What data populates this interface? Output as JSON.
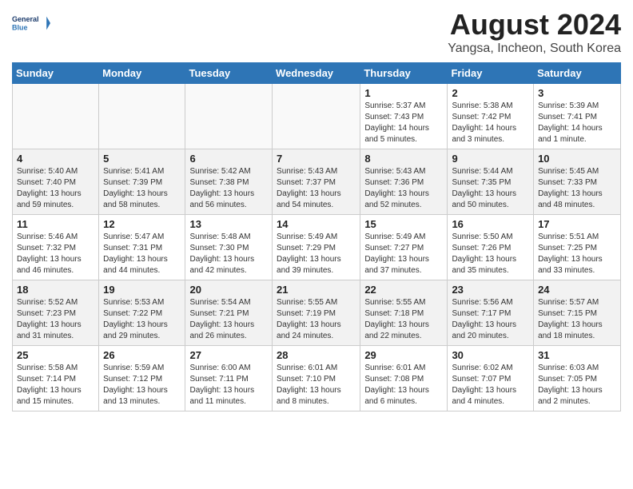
{
  "header": {
    "logo_line1": "General",
    "logo_line2": "Blue",
    "month_year": "August 2024",
    "location": "Yangsa, Incheon, South Korea"
  },
  "days_of_week": [
    "Sunday",
    "Monday",
    "Tuesday",
    "Wednesday",
    "Thursday",
    "Friday",
    "Saturday"
  ],
  "weeks": [
    [
      {
        "day": "",
        "info": ""
      },
      {
        "day": "",
        "info": ""
      },
      {
        "day": "",
        "info": ""
      },
      {
        "day": "",
        "info": ""
      },
      {
        "day": "1",
        "info": "Sunrise: 5:37 AM\nSunset: 7:43 PM\nDaylight: 14 hours\nand 5 minutes."
      },
      {
        "day": "2",
        "info": "Sunrise: 5:38 AM\nSunset: 7:42 PM\nDaylight: 14 hours\nand 3 minutes."
      },
      {
        "day": "3",
        "info": "Sunrise: 5:39 AM\nSunset: 7:41 PM\nDaylight: 14 hours\nand 1 minute."
      }
    ],
    [
      {
        "day": "4",
        "info": "Sunrise: 5:40 AM\nSunset: 7:40 PM\nDaylight: 13 hours\nand 59 minutes."
      },
      {
        "day": "5",
        "info": "Sunrise: 5:41 AM\nSunset: 7:39 PM\nDaylight: 13 hours\nand 58 minutes."
      },
      {
        "day": "6",
        "info": "Sunrise: 5:42 AM\nSunset: 7:38 PM\nDaylight: 13 hours\nand 56 minutes."
      },
      {
        "day": "7",
        "info": "Sunrise: 5:43 AM\nSunset: 7:37 PM\nDaylight: 13 hours\nand 54 minutes."
      },
      {
        "day": "8",
        "info": "Sunrise: 5:43 AM\nSunset: 7:36 PM\nDaylight: 13 hours\nand 52 minutes."
      },
      {
        "day": "9",
        "info": "Sunrise: 5:44 AM\nSunset: 7:35 PM\nDaylight: 13 hours\nand 50 minutes."
      },
      {
        "day": "10",
        "info": "Sunrise: 5:45 AM\nSunset: 7:33 PM\nDaylight: 13 hours\nand 48 minutes."
      }
    ],
    [
      {
        "day": "11",
        "info": "Sunrise: 5:46 AM\nSunset: 7:32 PM\nDaylight: 13 hours\nand 46 minutes."
      },
      {
        "day": "12",
        "info": "Sunrise: 5:47 AM\nSunset: 7:31 PM\nDaylight: 13 hours\nand 44 minutes."
      },
      {
        "day": "13",
        "info": "Sunrise: 5:48 AM\nSunset: 7:30 PM\nDaylight: 13 hours\nand 42 minutes."
      },
      {
        "day": "14",
        "info": "Sunrise: 5:49 AM\nSunset: 7:29 PM\nDaylight: 13 hours\nand 39 minutes."
      },
      {
        "day": "15",
        "info": "Sunrise: 5:49 AM\nSunset: 7:27 PM\nDaylight: 13 hours\nand 37 minutes."
      },
      {
        "day": "16",
        "info": "Sunrise: 5:50 AM\nSunset: 7:26 PM\nDaylight: 13 hours\nand 35 minutes."
      },
      {
        "day": "17",
        "info": "Sunrise: 5:51 AM\nSunset: 7:25 PM\nDaylight: 13 hours\nand 33 minutes."
      }
    ],
    [
      {
        "day": "18",
        "info": "Sunrise: 5:52 AM\nSunset: 7:23 PM\nDaylight: 13 hours\nand 31 minutes."
      },
      {
        "day": "19",
        "info": "Sunrise: 5:53 AM\nSunset: 7:22 PM\nDaylight: 13 hours\nand 29 minutes."
      },
      {
        "day": "20",
        "info": "Sunrise: 5:54 AM\nSunset: 7:21 PM\nDaylight: 13 hours\nand 26 minutes."
      },
      {
        "day": "21",
        "info": "Sunrise: 5:55 AM\nSunset: 7:19 PM\nDaylight: 13 hours\nand 24 minutes."
      },
      {
        "day": "22",
        "info": "Sunrise: 5:55 AM\nSunset: 7:18 PM\nDaylight: 13 hours\nand 22 minutes."
      },
      {
        "day": "23",
        "info": "Sunrise: 5:56 AM\nSunset: 7:17 PM\nDaylight: 13 hours\nand 20 minutes."
      },
      {
        "day": "24",
        "info": "Sunrise: 5:57 AM\nSunset: 7:15 PM\nDaylight: 13 hours\nand 18 minutes."
      }
    ],
    [
      {
        "day": "25",
        "info": "Sunrise: 5:58 AM\nSunset: 7:14 PM\nDaylight: 13 hours\nand 15 minutes."
      },
      {
        "day": "26",
        "info": "Sunrise: 5:59 AM\nSunset: 7:12 PM\nDaylight: 13 hours\nand 13 minutes."
      },
      {
        "day": "27",
        "info": "Sunrise: 6:00 AM\nSunset: 7:11 PM\nDaylight: 13 hours\nand 11 minutes."
      },
      {
        "day": "28",
        "info": "Sunrise: 6:01 AM\nSunset: 7:10 PM\nDaylight: 13 hours\nand 8 minutes."
      },
      {
        "day": "29",
        "info": "Sunrise: 6:01 AM\nSunset: 7:08 PM\nDaylight: 13 hours\nand 6 minutes."
      },
      {
        "day": "30",
        "info": "Sunrise: 6:02 AM\nSunset: 7:07 PM\nDaylight: 13 hours\nand 4 minutes."
      },
      {
        "day": "31",
        "info": "Sunrise: 6:03 AM\nSunset: 7:05 PM\nDaylight: 13 hours\nand 2 minutes."
      }
    ]
  ]
}
